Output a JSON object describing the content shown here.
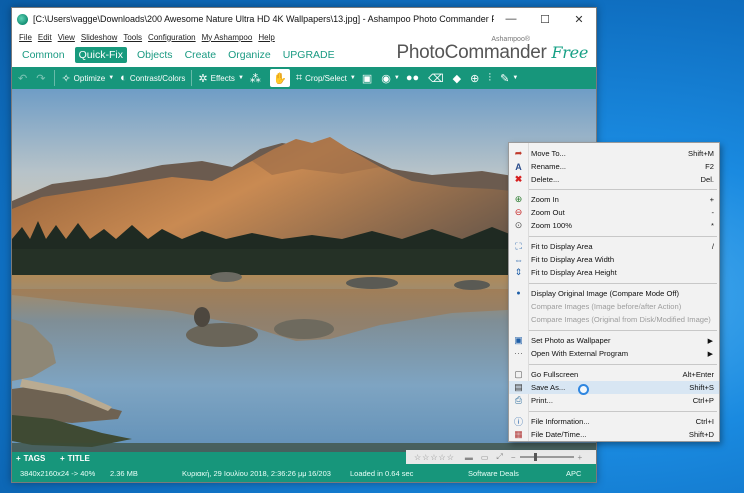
{
  "window": {
    "title": "[C:\\Users\\vagge\\Downloads\\200 Awesome Nature Ultra HD 4K Wallpapers\\13.jpg] - Ashampoo Photo Commander Free",
    "minimize": "—",
    "maximize": "☐",
    "close": "✕"
  },
  "menu": [
    "File",
    "Edit",
    "View",
    "Slideshow",
    "Tools",
    "Configuration",
    "My Ashampoo",
    "Help"
  ],
  "modes": [
    "Common",
    "Quick-Fix",
    "Objects",
    "Create",
    "Organize",
    "UPGRADE"
  ],
  "brand": {
    "small": "Ashampoo®",
    "main": "PhotoCommander",
    "free": "Free"
  },
  "toolbar": {
    "optimize": "Optimize",
    "contrast": "Contrast/Colors",
    "effects": "Effects",
    "crop": "Crop/Select"
  },
  "tags": {
    "tags": "TAGS",
    "title": "TITLE"
  },
  "status": {
    "dims": "3840x2160x24 -> 40%",
    "size": "2.36 MB",
    "date": "Κυριακή, 29 Ιουλίου 2018, 2:36:26 μμ",
    "index": "16/203",
    "loaded": "Loaded in 0.64 sec",
    "deals": "Software Deals",
    "apc": "APC"
  },
  "context_menu": [
    {
      "label": "Move To...",
      "shortcut": "Shift+M",
      "icon": "move-icon"
    },
    {
      "label": "Rename...",
      "shortcut": "F2",
      "icon": "rename-icon"
    },
    {
      "label": "Delete...",
      "shortcut": "Del.",
      "icon": "delete-icon"
    },
    {
      "label": "Zoom In",
      "shortcut": "+",
      "icon": "zoom-in-icon"
    },
    {
      "label": "Zoom Out",
      "shortcut": "-",
      "icon": "zoom-out-icon"
    },
    {
      "label": "Zoom 100%",
      "shortcut": "*",
      "icon": "zoom-100-icon"
    },
    {
      "label": "Fit to Display Area",
      "shortcut": "/",
      "icon": "fit-icon"
    },
    {
      "label": "Fit to Display Area Width",
      "shortcut": "",
      "icon": "fit-width-icon"
    },
    {
      "label": "Fit to Display Area Height",
      "shortcut": "",
      "icon": "fit-height-icon"
    },
    {
      "label": "Display Original Image (Compare Mode Off)",
      "shortcut": "",
      "icon": "radio-icon"
    },
    {
      "label": "Compare Images (Image before/after Action)",
      "shortcut": "",
      "icon": ""
    },
    {
      "label": "Compare Images (Original from Disk/Modified Image)",
      "shortcut": "",
      "icon": ""
    },
    {
      "label": "Set Photo as Wallpaper",
      "shortcut": "",
      "icon": "wallpaper-icon"
    },
    {
      "label": "Open With External Program",
      "shortcut": "",
      "icon": "external-icon"
    },
    {
      "label": "Go Fullscreen",
      "shortcut": "Alt+Enter",
      "icon": "fullscreen-icon"
    },
    {
      "label": "Save As...",
      "shortcut": "Shift+S",
      "icon": "save-icon"
    },
    {
      "label": "Print...",
      "shortcut": "Ctrl+P",
      "icon": "print-icon"
    },
    {
      "label": "File Information...",
      "shortcut": "Ctrl+I",
      "icon": "info-icon"
    },
    {
      "label": "File Date/Time...",
      "shortcut": "Shift+D",
      "icon": "datetime-icon"
    }
  ]
}
